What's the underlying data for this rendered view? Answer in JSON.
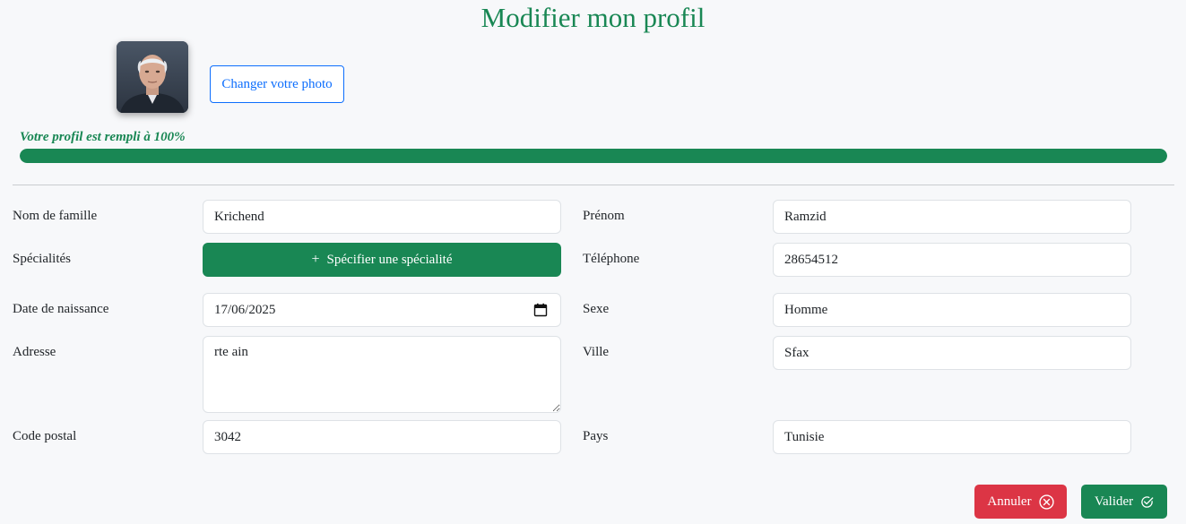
{
  "page": {
    "title": "Modifier mon profil"
  },
  "photo": {
    "change_label": "Changer votre photo"
  },
  "progress": {
    "label": "Votre profil est rempli à 100%",
    "percent": 100,
    "color": "#198754"
  },
  "form": {
    "nom": {
      "label": "Nom de famille",
      "value": "Krichend"
    },
    "prenom": {
      "label": "Prénom",
      "value": "Ramzid"
    },
    "specialites": {
      "label": "Spécialités",
      "button_label": "Spécifier une spécialité"
    },
    "telephone": {
      "label": "Téléphone",
      "value": "28654512"
    },
    "date_naissance": {
      "label": "Date de naissance",
      "value": "17/06/2025"
    },
    "sexe": {
      "label": "Sexe",
      "value": "Homme"
    },
    "adresse": {
      "label": "Adresse",
      "value": "rte ain"
    },
    "ville": {
      "label": "Ville",
      "value": "Sfax"
    },
    "code_postal": {
      "label": "Code postal",
      "value": "3042"
    },
    "pays": {
      "label": "Pays",
      "value": "Tunisie"
    }
  },
  "actions": {
    "cancel_label": "Annuler",
    "validate_label": "Valider",
    "cancel_color": "#dc3545",
    "validate_color": "#198754"
  },
  "icons": {
    "avatar": "avatar",
    "plus": "plus-icon",
    "calendar": "calendar-icon",
    "cancel": "circle-x-icon",
    "validate": "circle-check-icon"
  }
}
